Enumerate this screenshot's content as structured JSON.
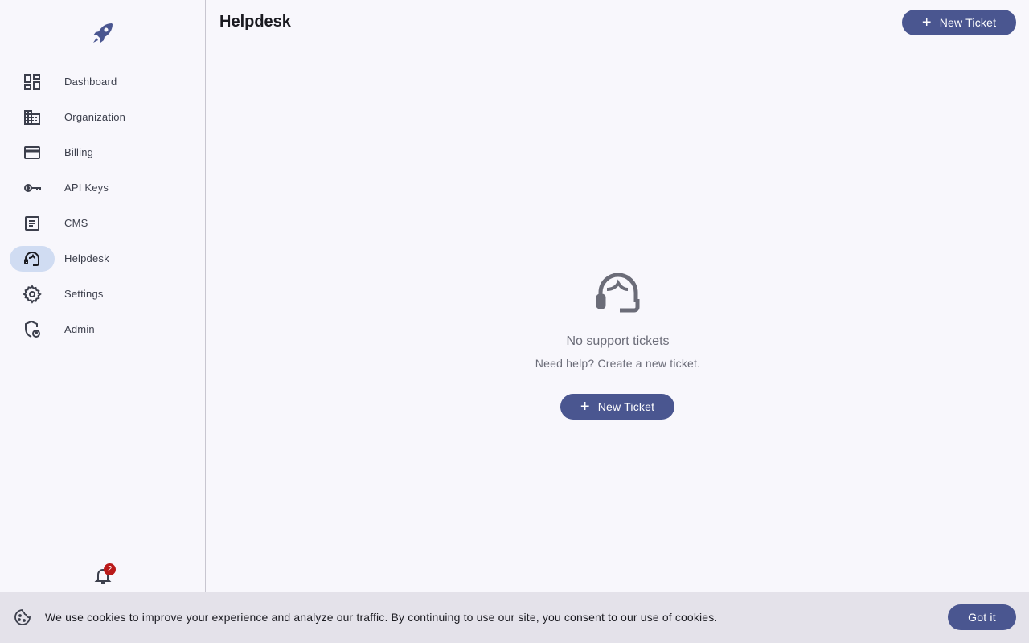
{
  "app": {
    "logo_icon": "rocket-icon",
    "accent": "#4a5690",
    "active_bg": "#d0dcf2"
  },
  "sidebar": {
    "items": [
      {
        "label": "Dashboard",
        "icon": "dashboard-icon",
        "active": false
      },
      {
        "label": "Organization",
        "icon": "building-icon",
        "active": false
      },
      {
        "label": "Billing",
        "icon": "credit-card-icon",
        "active": false
      },
      {
        "label": "API Keys",
        "icon": "key-icon",
        "active": false
      },
      {
        "label": "CMS",
        "icon": "article-icon",
        "active": false
      },
      {
        "label": "Helpdesk",
        "icon": "support-agent-icon",
        "active": true
      },
      {
        "label": "Settings",
        "icon": "gear-icon",
        "active": false
      },
      {
        "label": "Admin",
        "icon": "admin-shield-icon",
        "active": false
      }
    ],
    "notifications": {
      "icon": "bell-icon",
      "count": "2",
      "badge_color": "#ba1a1a"
    }
  },
  "header": {
    "title": "Helpdesk",
    "new_ticket_label": "New Ticket"
  },
  "empty_state": {
    "icon": "support-agent-icon",
    "title": "No support tickets",
    "subtitle": "Need help? Create a new ticket.",
    "button_label": "New Ticket"
  },
  "cookie_banner": {
    "icon": "cookie-icon",
    "text": "We use cookies to improve your experience and analyze our traffic. By continuing to use our site, you consent to our use of cookies.",
    "button_label": "Got it"
  }
}
